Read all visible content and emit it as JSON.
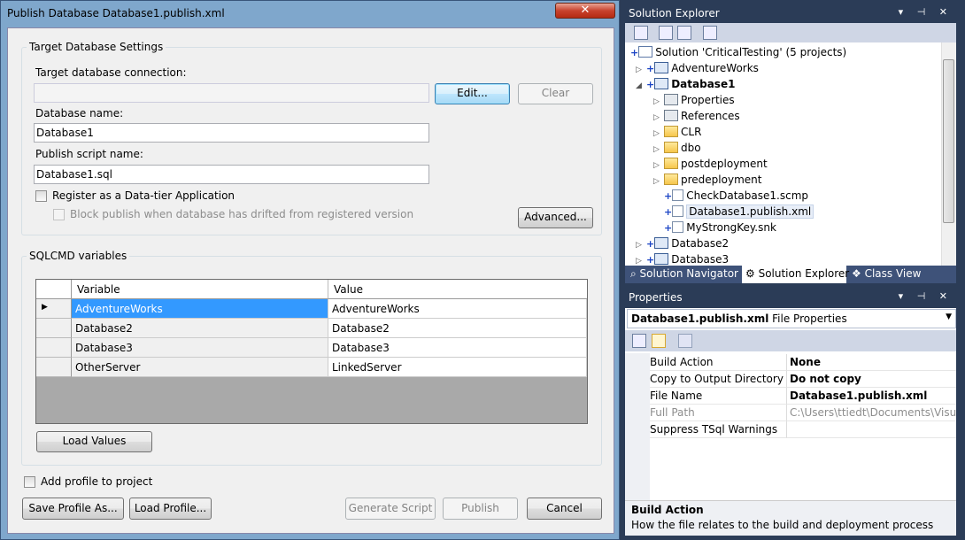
{
  "dialog": {
    "title": "Publish Database Database1.publish.xml",
    "close": "✕",
    "target": {
      "group_label": "Target Database Settings",
      "connection_label": "Target database connection:",
      "connection_value": "",
      "edit_button": "Edit...",
      "clear_button": "Clear",
      "dbname_label": "Database name:",
      "dbname_value": "Database1",
      "script_label": "Publish script name:",
      "script_value": "Database1.sql",
      "register_label": "Register as a Data-tier Application",
      "block_label": "Block publish when database has drifted from registered version",
      "advanced_button": "Advanced..."
    },
    "sqlcmd": {
      "group_label": "SQLCMD variables",
      "columns": [
        "Variable",
        "Value"
      ],
      "rows": [
        {
          "variable": "AdventureWorks",
          "value": "AdventureWorks"
        },
        {
          "variable": "Database2",
          "value": "Database2"
        },
        {
          "variable": "Database3",
          "value": "Database3"
        },
        {
          "variable": "OtherServer",
          "value": "LinkedServer"
        }
      ],
      "load_values_button": "Load Values"
    },
    "add_profile_label": "Add profile to project",
    "buttons": {
      "save_profile": "Save Profile As...",
      "load_profile": "Load Profile...",
      "generate_script": "Generate Script",
      "publish": "Publish",
      "cancel": "Cancel"
    }
  },
  "solution_explorer": {
    "title": "Solution Explorer",
    "pin_icons": "▾ ⊣ ✕",
    "tree": [
      "Solution 'CriticalTesting' (5 projects)",
      "AdventureWorks",
      "Database1",
      "Properties",
      "References",
      "CLR",
      "dbo",
      "postdeployment",
      "predeployment",
      "CheckDatabase1.scmp",
      "Database1.publish.xml",
      "MyStrongKey.snk",
      "Database2",
      "Database3"
    ],
    "tabs": [
      "Solution Navigator",
      "Solution Explorer",
      "Class View"
    ]
  },
  "properties": {
    "title": "Properties",
    "object_name": "Database1.publish.xml",
    "object_type": "File Properties",
    "rows": [
      {
        "name": "Build Action",
        "value": "None"
      },
      {
        "name": "Copy to Output Directory",
        "value": "Do not copy"
      },
      {
        "name": "File Name",
        "value": "Database1.publish.xml"
      },
      {
        "name": "Full Path",
        "value": "C:\\Users\\ttiedt\\Documents\\Visual St"
      },
      {
        "name": "Suppress TSql Warnings",
        "value": ""
      }
    ],
    "desc_title": "Build Action",
    "desc_text": "How the file relates to the build and deployment process"
  },
  "colors": {
    "dialog_frame": "#7fa7cc",
    "selection": "#3399ff",
    "panel_title": "#3e5279"
  }
}
